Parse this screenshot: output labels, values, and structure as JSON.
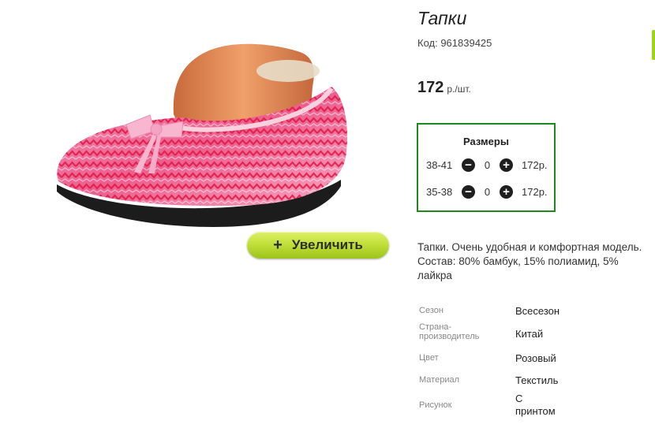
{
  "product": {
    "title": "Тапки",
    "code": "Код: 961839425",
    "price": "172",
    "price_unit": "р./шт."
  },
  "zoom_button": {
    "icon": "+",
    "label": "Увеличить"
  },
  "sizes": {
    "heading": "Размеры",
    "rows": [
      {
        "size": "38-41",
        "qty": "0",
        "price": "172р."
      },
      {
        "size": "35-38",
        "qty": "0",
        "price": "172р."
      }
    ]
  },
  "description": "Тапки. Очень удобная и комфортная модель. Состав: 80% бамбук, 15% полиамид, 5% лайкра",
  "attributes": [
    {
      "label": "Сезон",
      "value": "Всесезон"
    },
    {
      "label": "Страна-производитель",
      "value": "Китай"
    },
    {
      "label": "Цвет",
      "value": "Розовый"
    },
    {
      "label": "Материал",
      "value": "Текстиль"
    },
    {
      "label": "Рисунок",
      "value": "С принтом"
    }
  ],
  "colors": {
    "accent_green": "#1e8a1e",
    "button_green": "#c2e03a",
    "slipper_pink": "#f06292"
  }
}
